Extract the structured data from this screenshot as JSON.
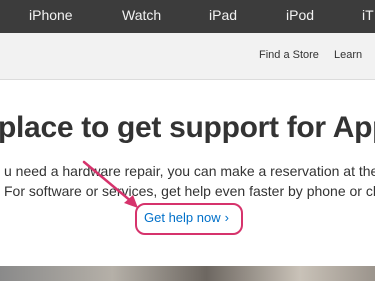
{
  "globalnav": {
    "items": [
      "iPhone",
      "Watch",
      "iPad",
      "iPod",
      "iT"
    ]
  },
  "subnav": {
    "find_store": "Find a Store",
    "learn": "Learn"
  },
  "hero": {
    "title": "place to get support for Apple",
    "line1": "u need a hardware repair, you can make a reservation at the G",
    "line2": "For software or services, get help even faster by phone or chat",
    "cta": "Get help now",
    "cta_chevron": "›"
  },
  "colors": {
    "nav_bg": "#3c3c3c",
    "link": "#0070c9",
    "highlight": "#d6336c"
  }
}
